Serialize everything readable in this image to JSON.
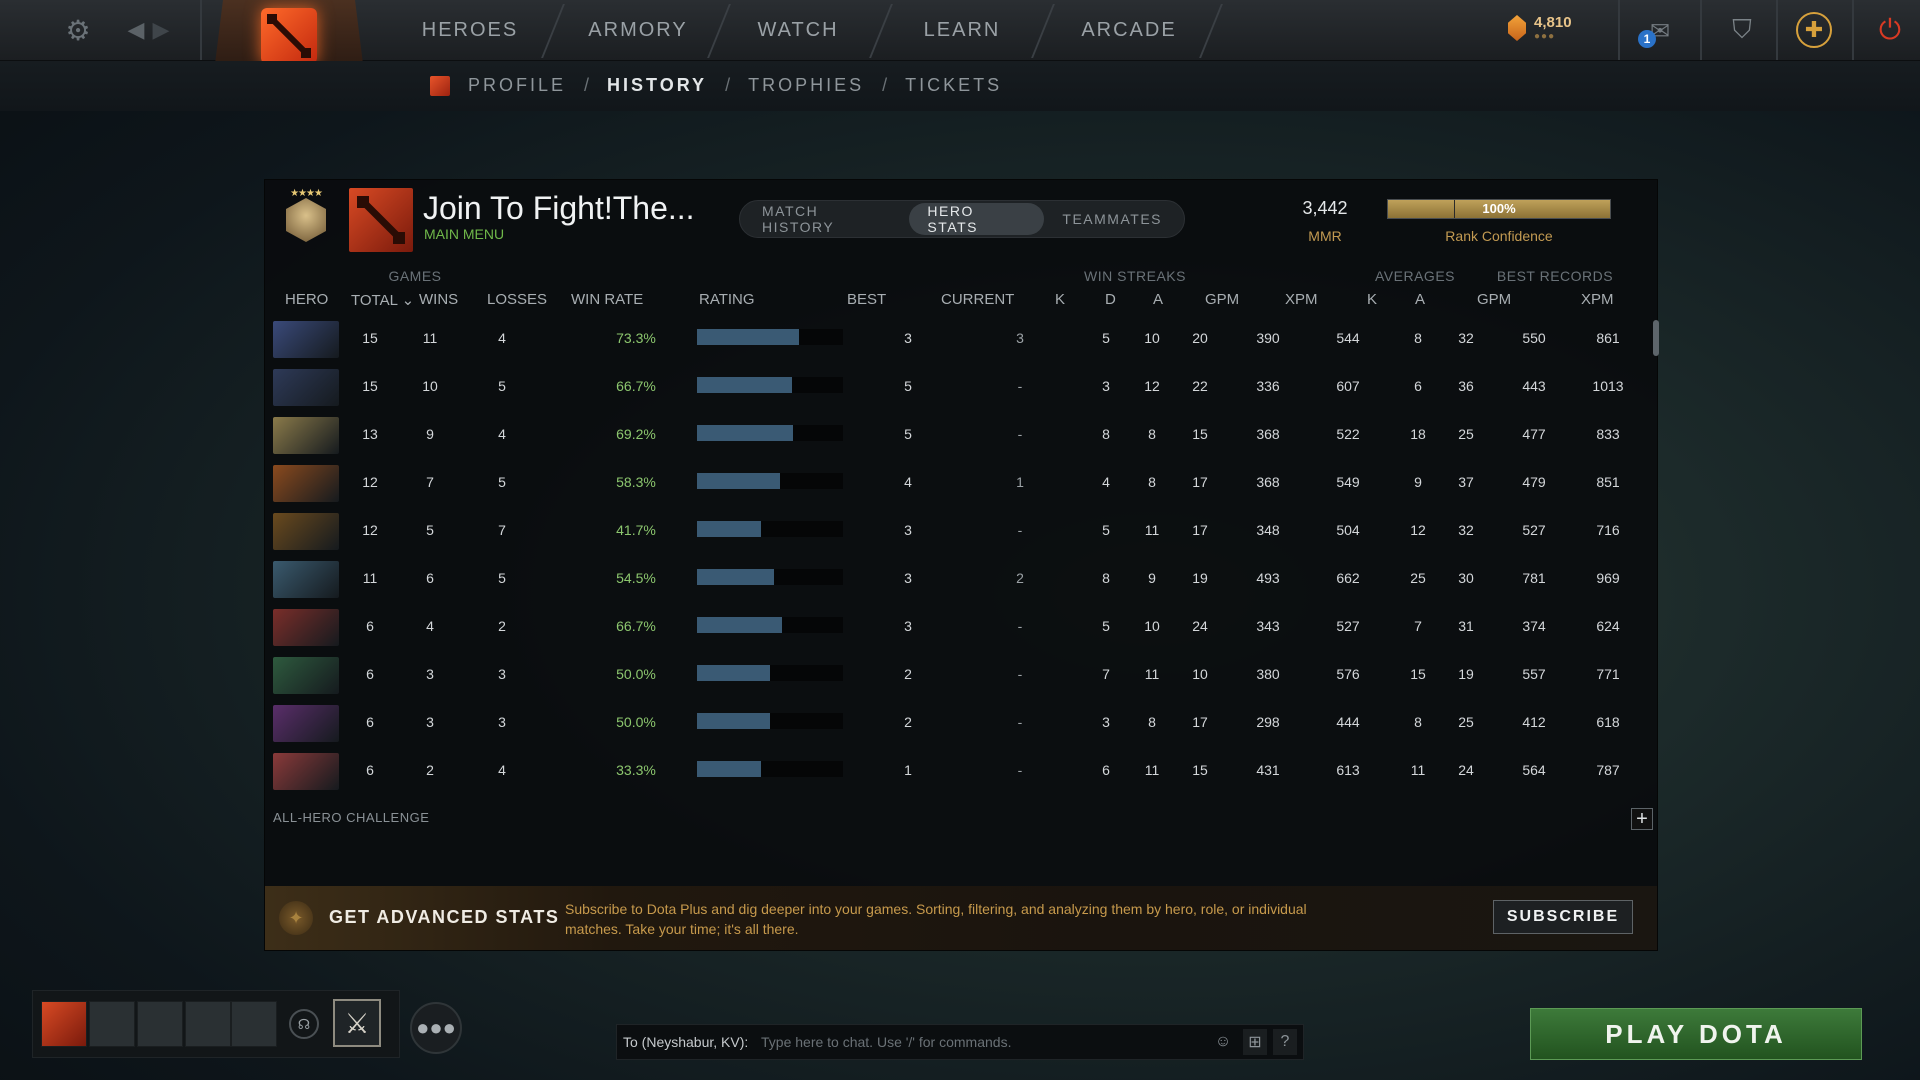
{
  "nav": {
    "tabs": [
      "HEROES",
      "ARMORY",
      "WATCH",
      "LEARN",
      "ARCADE"
    ],
    "gold": "4,810",
    "gold_dots": "●●●",
    "mail_count": "1"
  },
  "subnav": {
    "items": [
      "PROFILE",
      "HISTORY",
      "TROPHIES",
      "TICKETS"
    ],
    "active": "HISTORY"
  },
  "player": {
    "name": "Join To Fight!The...",
    "status": "MAIN MENU",
    "mmr": "3,442",
    "mmr_label": "MMR",
    "rank_confidence": "100%",
    "rank_confidence_value": 100,
    "rank_confidence_label": "Rank Confidence"
  },
  "tabs": [
    "MATCH HISTORY",
    "HERO STATS",
    "TEAMMATES"
  ],
  "active_tab": "HERO STATS",
  "table": {
    "groups": {
      "games": "GAMES",
      "win_streaks": "WIN STREAKS",
      "averages": "AVERAGES",
      "best_records": "BEST RECORDS"
    },
    "columns": {
      "hero": "HERO",
      "total": "TOTAL",
      "wins": "WINS",
      "losses": "LOSSES",
      "win_rate": "WIN RATE",
      "rating": "RATING",
      "best": "BEST",
      "current": "CURRENT",
      "avg_k": "K",
      "avg_d": "D",
      "avg_a": "A",
      "avg_gpm": "GPM",
      "avg_xpm": "XPM",
      "best_k": "K",
      "best_a": "A",
      "best_gpm": "GPM",
      "best_xpm": "XPM"
    },
    "sort_indicator": "⌄",
    "rows": [
      {
        "total": "15",
        "wins": "11",
        "losses": "4",
        "win_rate": "73.3%",
        "rating": 70,
        "best": "3",
        "current": "3",
        "avg_k": "5",
        "avg_d": "10",
        "avg_a": "20",
        "avg_gpm": "390",
        "avg_xpm": "544",
        "best_k": "8",
        "best_a": "32",
        "best_gpm": "550",
        "best_xpm": "861",
        "color": "#3a4a7a"
      },
      {
        "total": "15",
        "wins": "10",
        "losses": "5",
        "win_rate": "66.7%",
        "rating": 65,
        "best": "5",
        "current": "-",
        "avg_k": "3",
        "avg_d": "12",
        "avg_a": "22",
        "avg_gpm": "336",
        "avg_xpm": "607",
        "best_k": "6",
        "best_a": "36",
        "best_gpm": "443",
        "best_xpm": "1013",
        "color": "#2e3a58"
      },
      {
        "total": "13",
        "wins": "9",
        "losses": "4",
        "win_rate": "69.2%",
        "rating": 66,
        "best": "5",
        "current": "-",
        "avg_k": "8",
        "avg_d": "8",
        "avg_a": "15",
        "avg_gpm": "368",
        "avg_xpm": "522",
        "best_k": "18",
        "best_a": "25",
        "best_gpm": "477",
        "best_xpm": "833",
        "color": "#8a7a4a"
      },
      {
        "total": "12",
        "wins": "7",
        "losses": "5",
        "win_rate": "58.3%",
        "rating": 57,
        "best": "4",
        "current": "1",
        "avg_k": "4",
        "avg_d": "8",
        "avg_a": "17",
        "avg_gpm": "368",
        "avg_xpm": "549",
        "best_k": "9",
        "best_a": "37",
        "best_gpm": "479",
        "best_xpm": "851",
        "color": "#8a4a1e"
      },
      {
        "total": "12",
        "wins": "5",
        "losses": "7",
        "win_rate": "41.7%",
        "rating": 44,
        "best": "3",
        "current": "-",
        "avg_k": "5",
        "avg_d": "11",
        "avg_a": "17",
        "avg_gpm": "348",
        "avg_xpm": "504",
        "best_k": "12",
        "best_a": "32",
        "best_gpm": "527",
        "best_xpm": "716",
        "color": "#6a4a1e"
      },
      {
        "total": "11",
        "wins": "6",
        "losses": "5",
        "win_rate": "54.5%",
        "rating": 53,
        "best": "3",
        "current": "2",
        "avg_k": "8",
        "avg_d": "9",
        "avg_a": "19",
        "avg_gpm": "493",
        "avg_xpm": "662",
        "best_k": "25",
        "best_a": "30",
        "best_gpm": "781",
        "best_xpm": "969",
        "color": "#3a5a6e"
      },
      {
        "total": "6",
        "wins": "4",
        "losses": "2",
        "win_rate": "66.7%",
        "rating": 58,
        "best": "3",
        "current": "-",
        "avg_k": "5",
        "avg_d": "10",
        "avg_a": "24",
        "avg_gpm": "343",
        "avg_xpm": "527",
        "best_k": "7",
        "best_a": "31",
        "best_gpm": "374",
        "best_xpm": "624",
        "color": "#7a2e2a"
      },
      {
        "total": "6",
        "wins": "3",
        "losses": "3",
        "win_rate": "50.0%",
        "rating": 50,
        "best": "2",
        "current": "-",
        "avg_k": "7",
        "avg_d": "11",
        "avg_a": "10",
        "avg_gpm": "380",
        "avg_xpm": "576",
        "best_k": "15",
        "best_a": "19",
        "best_gpm": "557",
        "best_xpm": "771",
        "color": "#2e5a3e"
      },
      {
        "total": "6",
        "wins": "3",
        "losses": "3",
        "win_rate": "50.0%",
        "rating": 50,
        "best": "2",
        "current": "-",
        "avg_k": "3",
        "avg_d": "8",
        "avg_a": "17",
        "avg_gpm": "298",
        "avg_xpm": "444",
        "best_k": "8",
        "best_a": "25",
        "best_gpm": "412",
        "best_xpm": "618",
        "color": "#5a2e6a"
      },
      {
        "total": "6",
        "wins": "2",
        "losses": "4",
        "win_rate": "33.3%",
        "rating": 44,
        "best": "1",
        "current": "-",
        "avg_k": "6",
        "avg_d": "11",
        "avg_a": "15",
        "avg_gpm": "431",
        "avg_xpm": "613",
        "best_k": "11",
        "best_a": "24",
        "best_gpm": "564",
        "best_xpm": "787",
        "color": "#8a3a3a"
      }
    ],
    "challenge": "ALL-HERO CHALLENGE",
    "expand": "+"
  },
  "advanced": {
    "title": "GET ADVANCED STATS",
    "description": "Subscribe to Dota Plus and dig deeper into your games. Sorting, filtering, and analyzing them by hero, role, or individual matches. Take your time; it's all there.",
    "button": "SUBSCRIBE"
  },
  "chat": {
    "target": "To (Neyshabur, KV):",
    "placeholder": "Type here to chat. Use '/' for commands.",
    "help": "?"
  },
  "play_button": "PLAY DOTA",
  "icons": {
    "settings": "gear-icon",
    "back": "chevron-left-icon",
    "forward": "chevron-right-icon",
    "gold": "shard-icon",
    "mail": "mail-icon",
    "armory": "armory-icon",
    "dota_plus": "dota-plus-icon",
    "power": "power-icon",
    "friends": "friends-icon",
    "voice": "headset-icon",
    "emoji": "smiley-icon",
    "channel": "channel-icon"
  },
  "colors": {
    "accent_gold": "#c29a52",
    "status_green": "#70b84a",
    "play_green": "#3d7a3a",
    "rating_bar": "#3a5a74"
  }
}
